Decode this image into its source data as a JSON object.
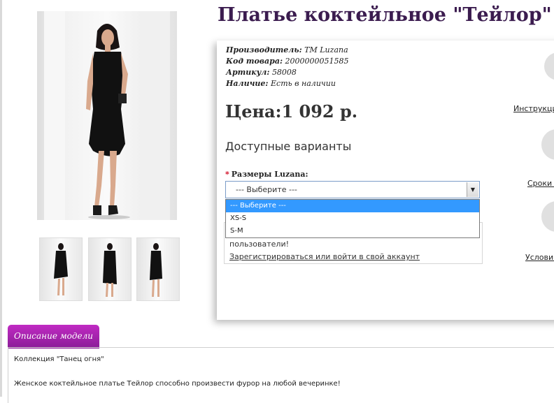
{
  "product": {
    "title": "Платье коктейльное \"Тейлор\"",
    "specs": [
      {
        "label": "Производитель:",
        "value": "ТМ Luzana"
      },
      {
        "label": "Код товара:",
        "value": "2000000051585"
      },
      {
        "label": "Артикул:",
        "value": "58008"
      },
      {
        "label": "Наличие:",
        "value": "Есть в наличии"
      }
    ],
    "price": "Цена:1 092 р."
  },
  "variants": {
    "title": "Доступные варианты",
    "size_label": "Размеры Luzana:",
    "required_mark": "*",
    "select_value": "--- Выберите ---",
    "options": [
      "--- Выберите ---",
      "XS-S",
      "S-M"
    ]
  },
  "login_note": {
    "text": "пользователи!",
    "link": "Зарегистрироваться или войти в свой аккаунт"
  },
  "side_links": [
    "Инструкци",
    "Сроки д",
    "Условия"
  ],
  "description": {
    "tab_label": "Описание модели",
    "lines": [
      "Коллекция \"Танец огня\"",
      "Женское коктейльное платье Тейлор способно произвести фурор на любой вечеринке!"
    ]
  },
  "colors": {
    "title": "#3b1c4f",
    "tab": "#a024ad",
    "dress": "#111111",
    "select_highlight": "#3399ff"
  }
}
